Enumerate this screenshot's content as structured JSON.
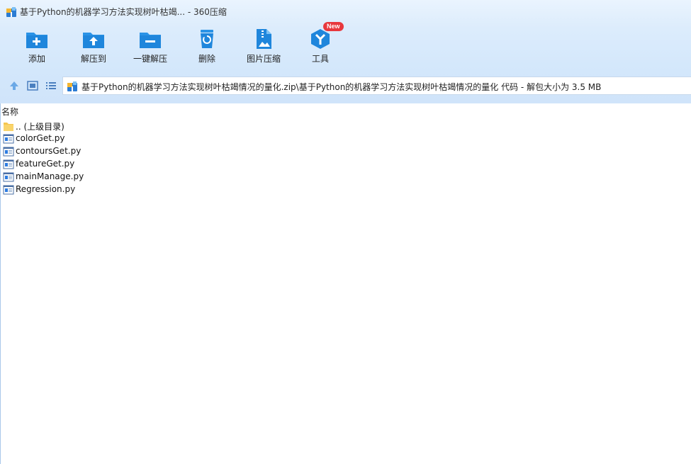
{
  "window": {
    "title": "基于Python的机器学习方法实现树叶枯竭... - 360压缩"
  },
  "toolbar": {
    "items": [
      {
        "label": "添加",
        "icon": "add-folder-icon"
      },
      {
        "label": "解压到",
        "icon": "extract-to-icon"
      },
      {
        "label": "一键解压",
        "icon": "one-click-extract-icon"
      },
      {
        "label": "删除",
        "icon": "recycle-bin-icon"
      },
      {
        "label": "图片压缩",
        "icon": "image-compress-icon"
      },
      {
        "label": "工具",
        "icon": "tools-icon",
        "badge": "New"
      }
    ]
  },
  "nav": {
    "path": "基于Python的机器学习方法实现树叶枯竭情况的量化.zip\\基于Python的机器学习方法实现树叶枯竭情况的量化 代码 - 解包大小为 3.5 MB"
  },
  "list": {
    "column_name": "名称",
    "items": [
      {
        "name": ".. (上级目录)",
        "type": "folder"
      },
      {
        "name": "colorGet.py",
        "type": "file"
      },
      {
        "name": "contoursGet.py",
        "type": "file"
      },
      {
        "name": "featureGet.py",
        "type": "file"
      },
      {
        "name": "mainManage.py",
        "type": "file"
      },
      {
        "name": "Regression.py",
        "type": "file"
      }
    ]
  },
  "colors": {
    "accent": "#1e8ee8",
    "badge": "#e8383d",
    "band": "#d3e7fb"
  }
}
